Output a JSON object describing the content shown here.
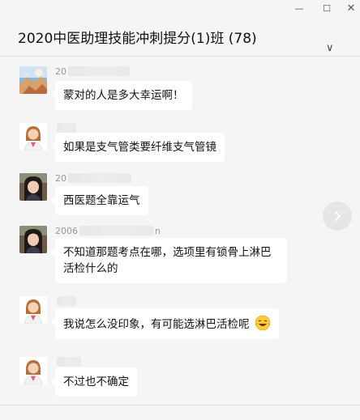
{
  "window": {
    "minimize_glyph": "—",
    "maximize_glyph": "☐",
    "close_glyph": "✕"
  },
  "header": {
    "title": "2020中医助理技能冲刺提分(1)班 (78)",
    "more_glyph": "∨"
  },
  "messages": [
    {
      "sender_prefix": "20",
      "text": "蒙对的人是多大幸运啊！",
      "avatar": "scenery-avatar"
    },
    {
      "sender_prefix": "",
      "text": "如果是支气管类要纤维支气管镜",
      "avatar": "doctor-avatar"
    },
    {
      "sender_prefix": "20",
      "text": "西医题全靠运气",
      "avatar": "girl-avatar"
    },
    {
      "sender_prefix": "2006",
      "sender_suffix": "n",
      "text": "不知道那题考点在哪，选项里有锁骨上淋巴活检什么的",
      "avatar": "girl-avatar"
    },
    {
      "sender_prefix": "",
      "text": "我说怎么没印象，有可能选淋巴活检呢",
      "emoji": "laughing-crying-emoji",
      "avatar": "doctor-avatar"
    },
    {
      "sender_prefix": "",
      "text": "不过也不确定",
      "avatar": "doctor-avatar"
    }
  ],
  "next_button_icon": "chevron-right-icon",
  "colors": {
    "background": "#f5f5f5",
    "bubble": "#ffffff",
    "sender_text": "#999999"
  }
}
